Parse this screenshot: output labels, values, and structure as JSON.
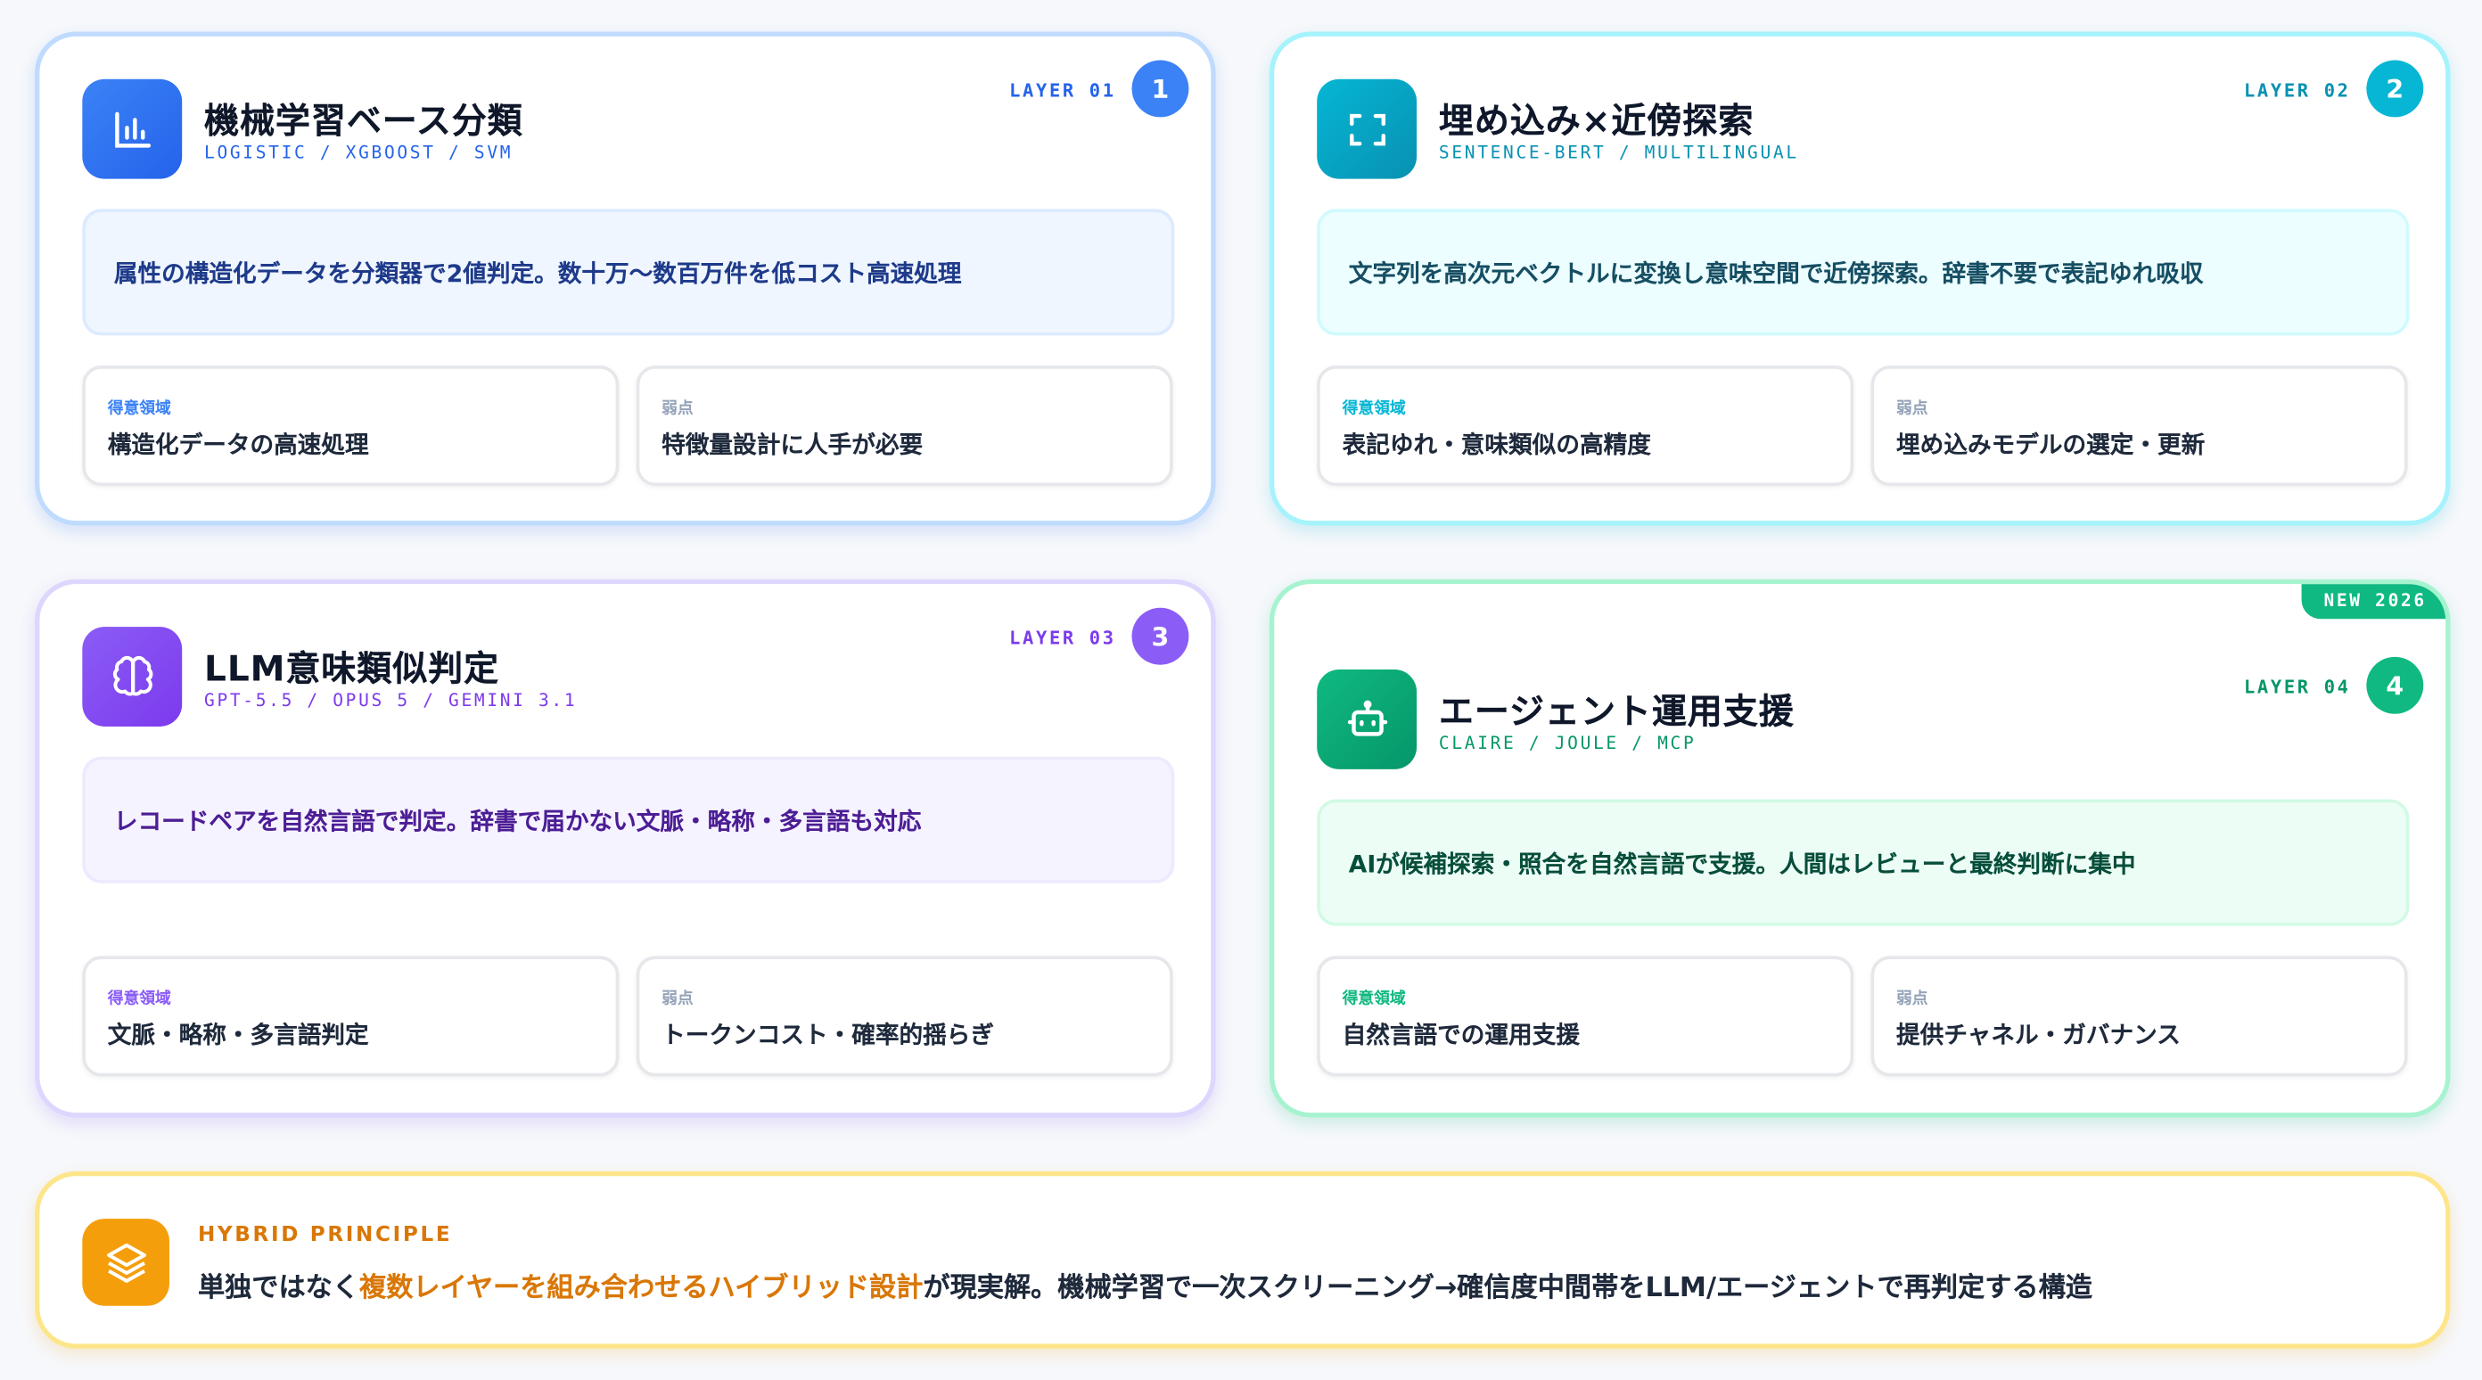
{
  "colors": {
    "layer1": "#3b82f6",
    "layer2": "#06b6d4",
    "layer3": "#8b5cf6",
    "layer4": "#10b981",
    "hybrid": "#f59e0b"
  },
  "cards": [
    {
      "icon": "bar-chart-icon",
      "title": "機械学習ベース分類",
      "subtitle": "LOGISTIC / XGBOOST / SVM",
      "layer": "LAYER 01",
      "number": "1",
      "description": "属性の構造化データを分類器で2値判定。数十万〜数百万件を低コスト高速処理",
      "strength_label": "得意領域",
      "strength": "構造化データの高速処理",
      "weakness_label": "弱点",
      "weakness": "特徴量設計に人手が必要"
    },
    {
      "icon": "scan-frame-icon",
      "title": "埋め込み×近傍探索",
      "subtitle": "SENTENCE-BERT / MULTILINGUAL",
      "layer": "LAYER 02",
      "number": "2",
      "description": "文字列を高次元ベクトルに変換し意味空間で近傍探索。辞書不要で表記ゆれ吸収",
      "strength_label": "得意領域",
      "strength": "表記ゆれ・意味類似の高精度",
      "weakness_label": "弱点",
      "weakness": "埋め込みモデルの選定・更新"
    },
    {
      "icon": "brain-icon",
      "title": "LLM意味類似判定",
      "subtitle": "GPT-5.5 / OPUS 5 / GEMINI 3.1",
      "layer": "LAYER 03",
      "number": "3",
      "description": "レコードペアを自然言語で判定。辞書で届かない文脈・略称・多言語も対応",
      "strength_label": "得意領域",
      "strength": "文脈・略称・多言語判定",
      "weakness_label": "弱点",
      "weakness": "トークンコスト・確率的揺らぎ"
    },
    {
      "icon": "robot-icon",
      "title": "エージェント運用支援",
      "subtitle": "CLAIRE / JOULE / MCP",
      "layer": "LAYER 04",
      "number": "4",
      "badge": "NEW 2026",
      "description": "AIが候補探索・照合を自然言語で支援。人間はレビューと最終判断に集中",
      "strength_label": "得意領域",
      "strength": "自然言語での運用支援",
      "weakness_label": "弱点",
      "weakness": "提供チャネル・ガバナンス"
    }
  ],
  "hybrid": {
    "icon": "layers-icon",
    "heading": "HYBRID PRINCIPLE",
    "text_before": "単独ではなく",
    "text_highlight": "複数レイヤーを組み合わせるハイブリッド設計",
    "text_after": "が現実解。機械学習で一次スクリーニング→確信度中間帯をLLM/エージェントで再判定する構造"
  }
}
